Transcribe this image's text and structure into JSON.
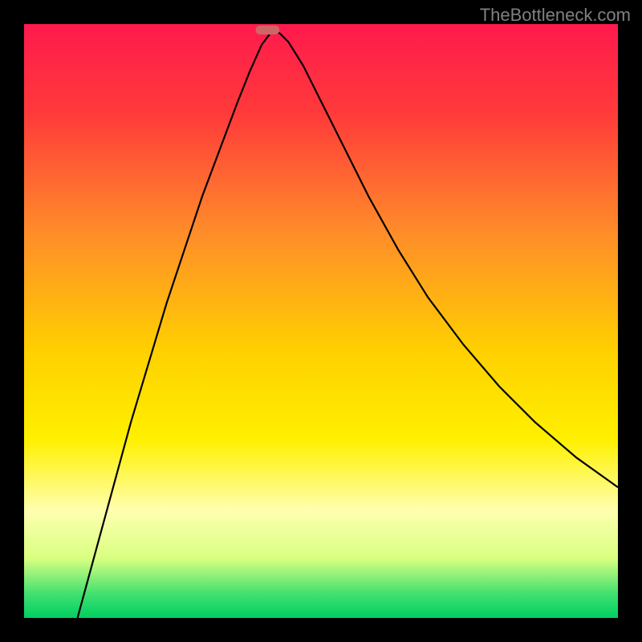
{
  "watermark": "TheBottleneck.com",
  "chart_data": {
    "type": "line",
    "title": "",
    "xlabel": "",
    "ylabel": "",
    "xlim": [
      0,
      100
    ],
    "ylim": [
      0,
      100
    ],
    "background_gradient": {
      "stops": [
        {
          "offset": 0,
          "color": "#ff1a4d"
        },
        {
          "offset": 15,
          "color": "#ff3a3a"
        },
        {
          "offset": 35,
          "color": "#ff8c2a"
        },
        {
          "offset": 55,
          "color": "#ffd000"
        },
        {
          "offset": 70,
          "color": "#fff000"
        },
        {
          "offset": 82,
          "color": "#ffffb0"
        },
        {
          "offset": 90,
          "color": "#d8ff80"
        },
        {
          "offset": 96,
          "color": "#40e070"
        },
        {
          "offset": 100,
          "color": "#00d060"
        }
      ]
    },
    "marker": {
      "x": 41,
      "y": 99,
      "width": 4,
      "height": 1.5,
      "color": "#d06565"
    },
    "series": [
      {
        "name": "curve",
        "color": "#000000",
        "stroke_width": 2.2,
        "points": [
          {
            "x": 9,
            "y": 0
          },
          {
            "x": 12,
            "y": 11
          },
          {
            "x": 15,
            "y": 22
          },
          {
            "x": 18,
            "y": 33
          },
          {
            "x": 21,
            "y": 43
          },
          {
            "x": 24,
            "y": 53
          },
          {
            "x": 27,
            "y": 62
          },
          {
            "x": 30,
            "y": 71
          },
          {
            "x": 33,
            "y": 79
          },
          {
            "x": 36,
            "y": 87
          },
          {
            "x": 38,
            "y": 92
          },
          {
            "x": 40,
            "y": 96.5
          },
          {
            "x": 41.5,
            "y": 98.5
          },
          {
            "x": 43,
            "y": 98.5
          },
          {
            "x": 44.5,
            "y": 97
          },
          {
            "x": 47,
            "y": 93
          },
          {
            "x": 50,
            "y": 87
          },
          {
            "x": 54,
            "y": 79
          },
          {
            "x": 58,
            "y": 71
          },
          {
            "x": 63,
            "y": 62
          },
          {
            "x": 68,
            "y": 54
          },
          {
            "x": 74,
            "y": 46
          },
          {
            "x": 80,
            "y": 39
          },
          {
            "x": 86,
            "y": 33
          },
          {
            "x": 93,
            "y": 27
          },
          {
            "x": 100,
            "y": 22
          }
        ]
      }
    ]
  }
}
